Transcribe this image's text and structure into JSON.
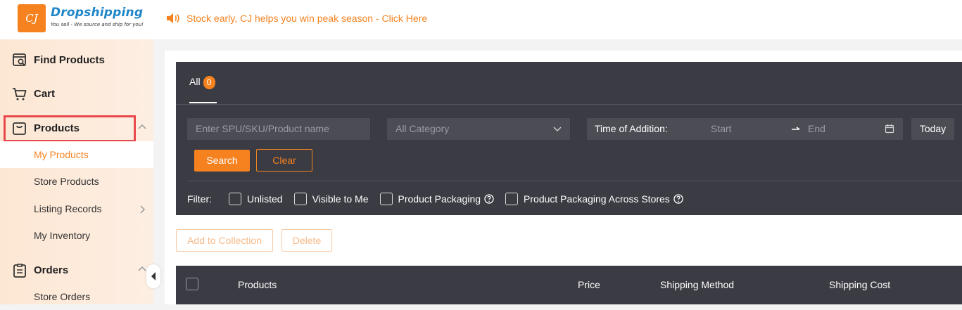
{
  "header": {
    "logo_mark": "CJ",
    "logo_title": "Dropshipping",
    "logo_tagline": "You sell - We source and ship for you!",
    "promo_text": "Stock early, CJ helps you win peak season - Click Here"
  },
  "sidebar": {
    "find_products": "Find Products",
    "cart": "Cart",
    "products": "Products",
    "sub_items": [
      "My Products",
      "Store Products",
      "Listing Records",
      "My Inventory"
    ],
    "orders": "Orders",
    "store_orders": "Store Orders"
  },
  "tabs": {
    "all_label": "All",
    "all_count": "0"
  },
  "search": {
    "sku_placeholder": "Enter SPU/SKU/Product name",
    "category_value": "All Category",
    "time_label": "Time of Addition:",
    "start_placeholder": "Start",
    "end_placeholder": "End",
    "today_label": "Today",
    "search_label": "Search",
    "clear_label": "Clear"
  },
  "filters": {
    "label": "Filter:",
    "options": [
      "Unlisted",
      "Visible to Me",
      "Product Packaging",
      "Product Packaging Across Stores"
    ]
  },
  "actions": {
    "add_to_collection": "Add to Collection",
    "delete": "Delete"
  },
  "table": {
    "columns": [
      "Products",
      "Price",
      "Shipping Method",
      "Shipping Cost"
    ]
  },
  "colors": {
    "accent": "#f5821f",
    "panel": "#3b3b43",
    "highlight": "#e8484a",
    "logo_blue": "#1f86c8"
  }
}
